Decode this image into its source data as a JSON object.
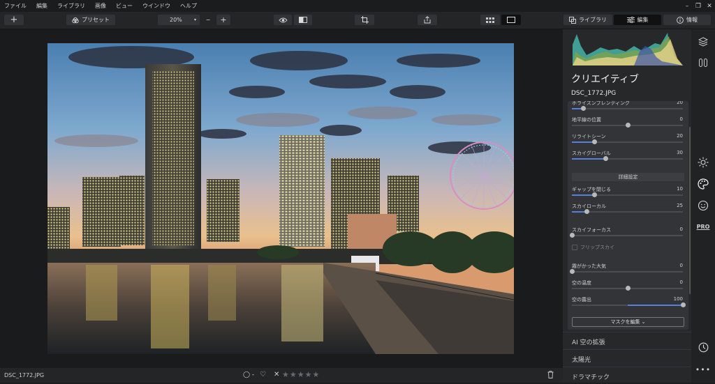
{
  "menu": [
    "ファイル",
    "編集",
    "ライブラリ",
    "画像",
    "ビュー",
    "ウインドウ",
    "ヘルプ"
  ],
  "window_controls": {
    "minimize": "–",
    "restore": "❐",
    "close": "✕"
  },
  "toolbar": {
    "add_label": "+",
    "preset_label": "プリセット",
    "zoom_value": "20%",
    "zoom_out_label": "−",
    "zoom_in_label": "+"
  },
  "tabs": {
    "library": "ライブラリ",
    "edit": "編集",
    "info": "情報"
  },
  "panel": {
    "title": "クリエイティブ",
    "filename": "DSC_1772.JPG",
    "sliders_top": [
      {
        "label": "ホライズンブレンディング",
        "value": "20",
        "level": 0.1
      },
      {
        "label": "地平線の位置",
        "value": "0",
        "level": 0.5
      },
      {
        "label": "リライトシーン",
        "value": "20",
        "level": 0.2
      },
      {
        "label": "スカイグローバル",
        "value": "30",
        "level": 0.3
      }
    ],
    "advanced_header": "詳細設定",
    "sliders_adv": [
      {
        "label": "ギャップを閉じる",
        "value": "10",
        "level": 0.2
      },
      {
        "label": "スカイローカル",
        "value": "25",
        "level": 0.13
      }
    ],
    "sliders_mid": [
      {
        "label": "スカイフォーカス",
        "value": "0",
        "level": 0.0
      }
    ],
    "flip_sky_label": "フリップスカイ",
    "sliders_bottom": [
      {
        "label": "霧がかった大気",
        "value": "0",
        "level": 0.0
      },
      {
        "label": "空の温度",
        "value": "0",
        "level": 0.5
      },
      {
        "label": "空の露出",
        "value": "100",
        "level": 1.0
      }
    ],
    "mask_button": "マスクを編集 ⌄",
    "list": [
      "AI 空の拡張",
      "太陽光",
      "ドラマチック"
    ]
  },
  "status": {
    "filename": "DSC_1772.JPG",
    "rating_placeholder": "◯ -",
    "stars": "★★★★★"
  },
  "rail": {
    "pro_label": "PRO"
  },
  "colors": {
    "accent": "#5a7fd6",
    "panel": "#27282a",
    "card": "#333437"
  }
}
